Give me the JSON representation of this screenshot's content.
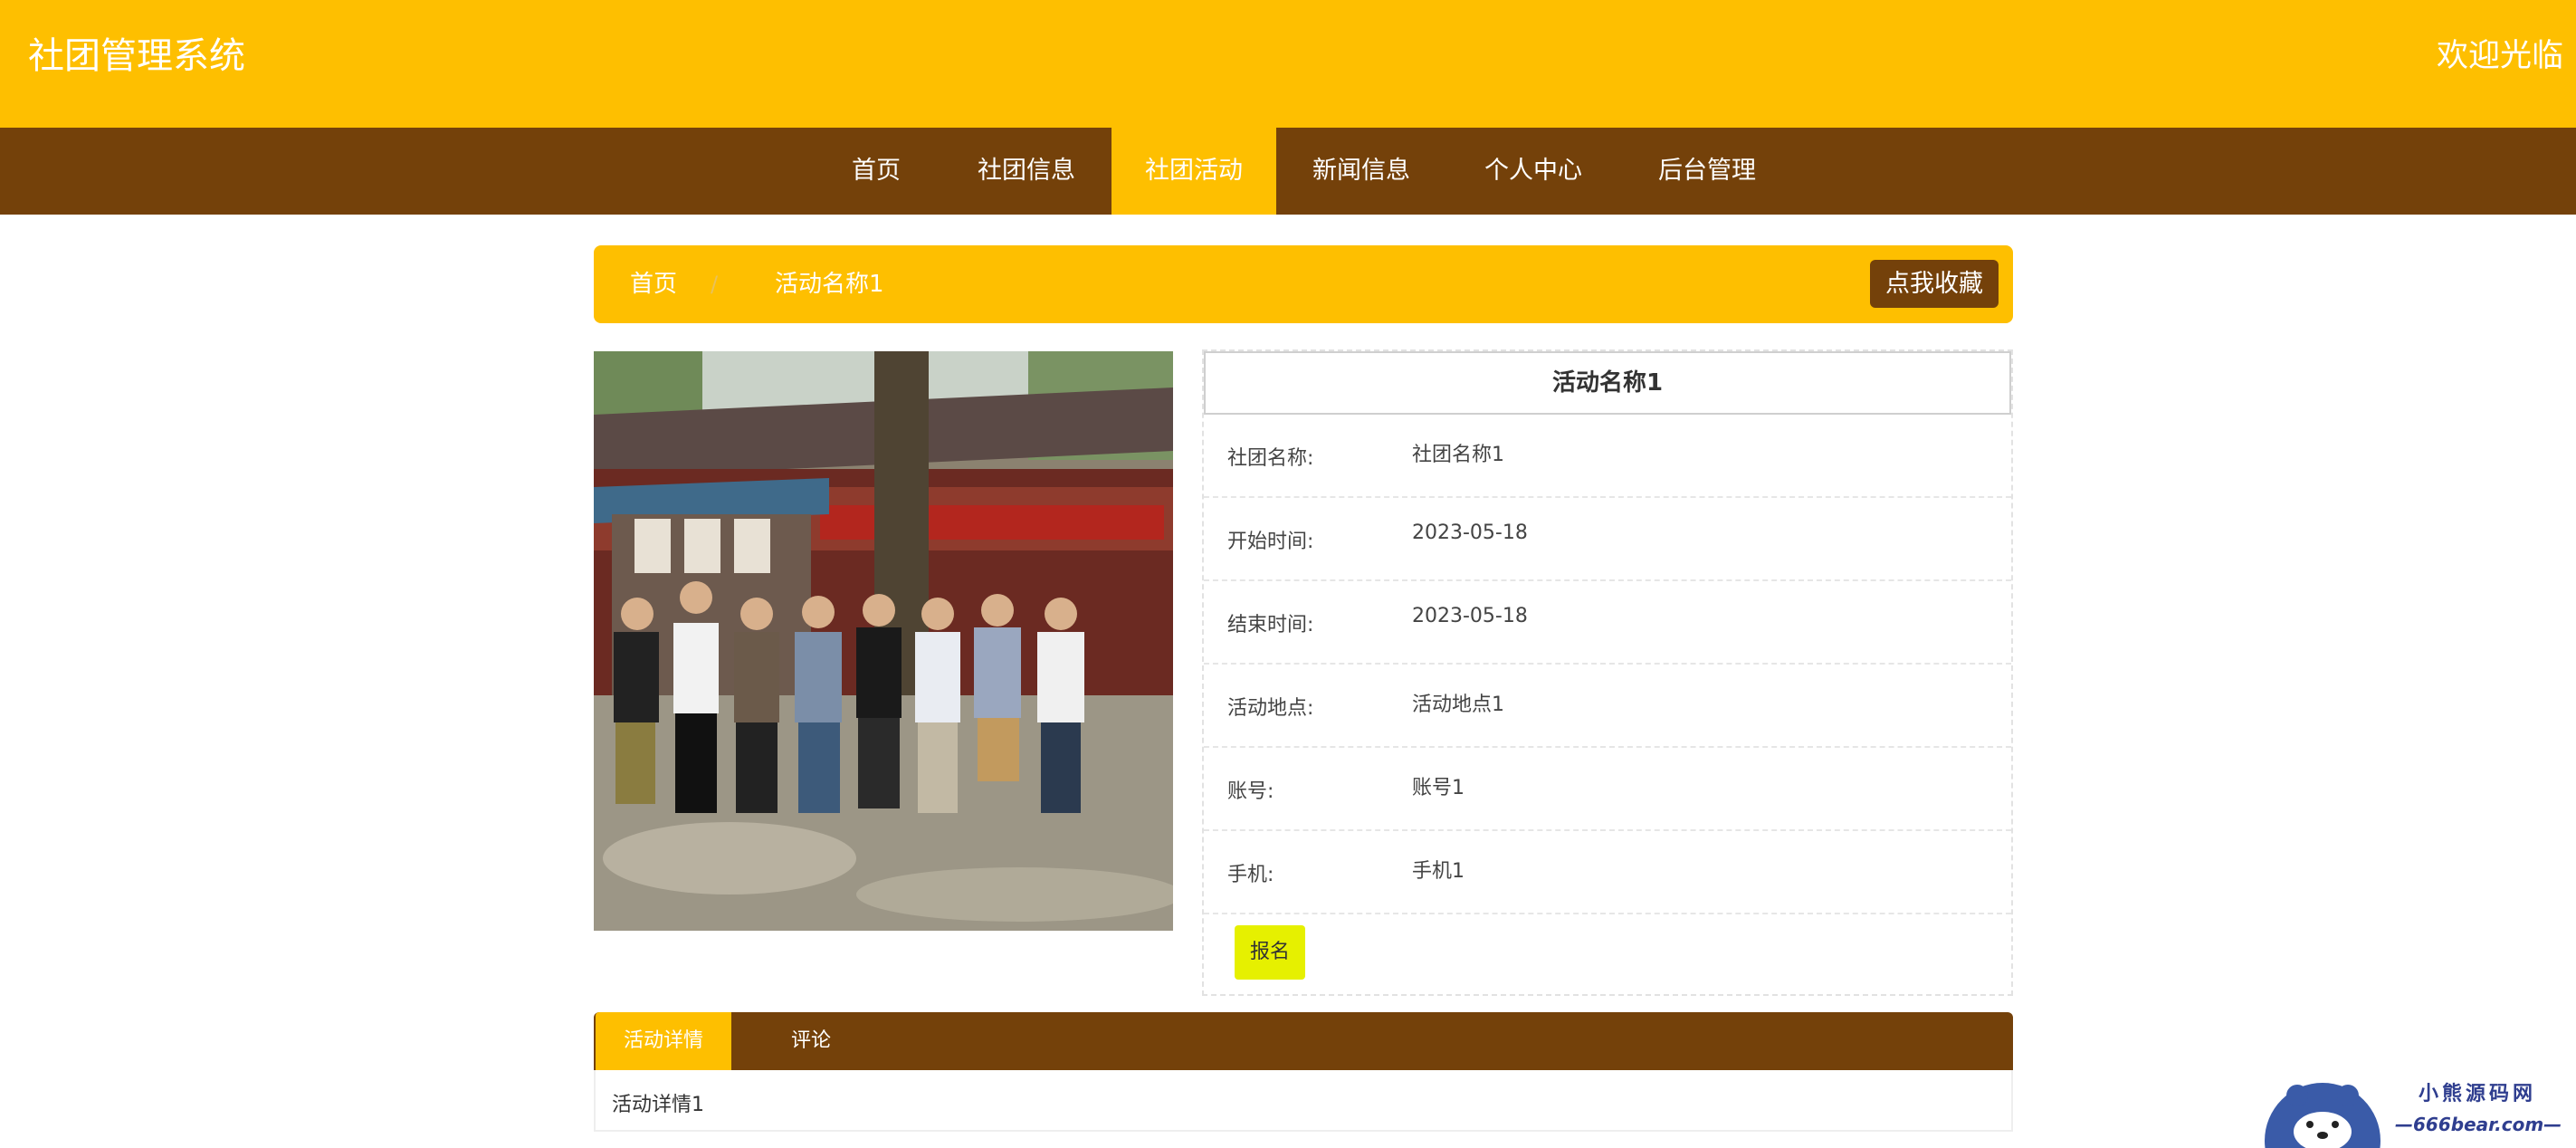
{
  "header": {
    "site_title": "社团管理系统",
    "welcome": "欢迎光临"
  },
  "nav": {
    "items": [
      "首页",
      "社团信息",
      "社团活动",
      "新闻信息",
      "个人中心",
      "后台管理"
    ],
    "active": "社团活动"
  },
  "breadcrumb": {
    "home": "首页",
    "separator": "/",
    "current": "活动名称1",
    "favorite_button": "点我收藏"
  },
  "activity": {
    "title": "活动名称1",
    "fields": [
      {
        "label": "社团名称:",
        "value": "社团名称1"
      },
      {
        "label": "开始时间:",
        "value": "2023-05-18"
      },
      {
        "label": "结束时间:",
        "value": "2023-05-18"
      },
      {
        "label": "活动地点:",
        "value": "活动地点1"
      },
      {
        "label": "账号:",
        "value": "账号1"
      },
      {
        "label": "手机:",
        "value": "手机1"
      }
    ],
    "signup_button": "报名"
  },
  "tabs": {
    "items": [
      "活动详情",
      "评论"
    ],
    "active": "活动详情",
    "content": "活动详情1"
  },
  "watermark": {
    "cn": "小熊源码网",
    "en": "—666bear.com—"
  },
  "colors": {
    "primary_yellow": "#FEBF00",
    "primary_brown": "#74410A",
    "signup_yellow": "#E6F000"
  }
}
